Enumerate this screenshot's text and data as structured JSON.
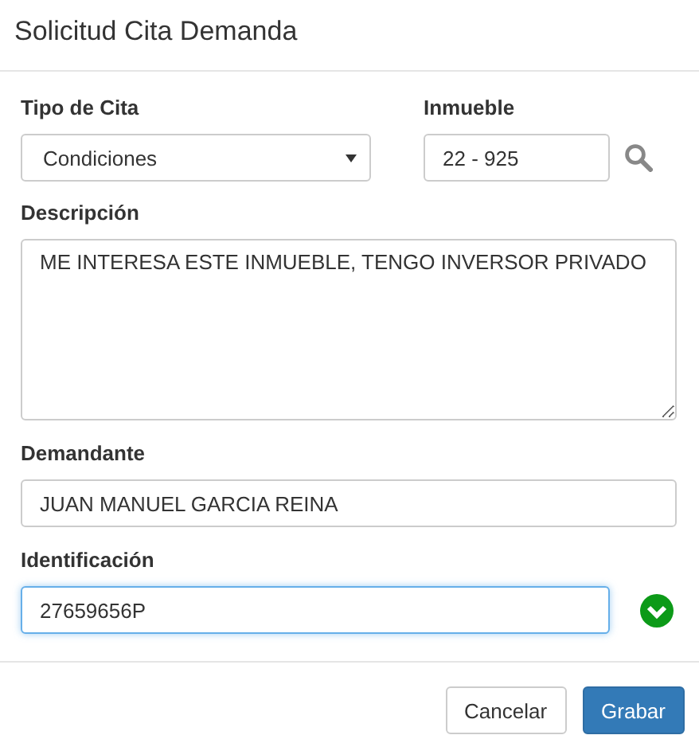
{
  "window": {
    "title": "Solicitud Cita Demanda"
  },
  "tipo_cita": {
    "label": "Tipo de Cita",
    "value": "Condiciones"
  },
  "inmueble": {
    "label": "Inmueble",
    "value": "22 - 925"
  },
  "descripcion": {
    "label": "Descripción",
    "value": "ME INTERESA ESTE INMUEBLE, TENGO INVERSOR PRIVADO"
  },
  "demandante": {
    "label": "Demandante",
    "value": "JUAN MANUEL GARCIA REINA",
    "focused": false
  },
  "identificacion": {
    "label": "Identificación",
    "value": "27659656P",
    "focused": true,
    "valid": true
  },
  "buttons": [
    {
      "label": "Cancelar",
      "kind": "default"
    },
    {
      "label": "Grabar",
      "kind": "primary"
    }
  ]
}
